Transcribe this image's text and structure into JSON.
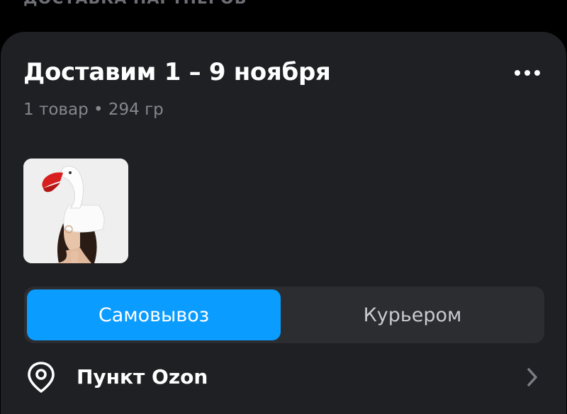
{
  "header": {
    "section_label": "ДОСТАВКА ПАРТНЕРОВ"
  },
  "shipment": {
    "title": "Доставим 1 – 9 ноября",
    "summary": "1 товар • 294 гр",
    "more_icon": "more-horizontal-icon",
    "product_image": "goose-hat-product-photo"
  },
  "delivery_method": {
    "options": [
      "Самовывоз",
      "Курьером"
    ],
    "selected": "Самовывоз",
    "accent_color": "#0a9cff"
  },
  "pickup": {
    "label": "Пункт Ozon",
    "icon": "location-pin-icon",
    "chevron": "chevron-right-icon"
  }
}
